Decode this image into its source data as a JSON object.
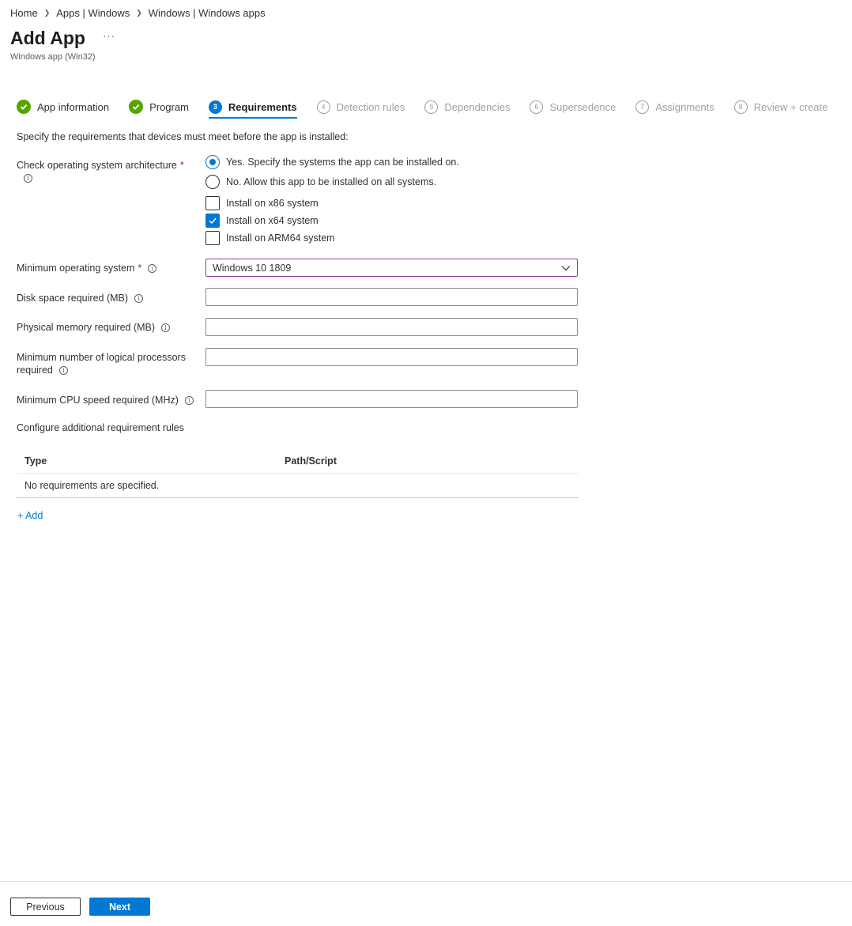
{
  "breadcrumb": {
    "items": [
      "Home",
      "Apps | Windows",
      "Windows | Windows apps"
    ]
  },
  "header": {
    "title": "Add App",
    "more": "···",
    "subtitle": "Windows app (Win32)"
  },
  "steps": [
    {
      "label": "App information",
      "state": "done"
    },
    {
      "label": "Program",
      "state": "done"
    },
    {
      "label": "Requirements",
      "state": "current",
      "number": "3"
    },
    {
      "label": "Detection rules",
      "state": "todo",
      "number": "4"
    },
    {
      "label": "Dependencies",
      "state": "todo",
      "number": "5"
    },
    {
      "label": "Supersedence",
      "state": "todo",
      "number": "6"
    },
    {
      "label": "Assignments",
      "state": "todo",
      "number": "7"
    },
    {
      "label": "Review + create",
      "state": "todo",
      "number": "8"
    }
  ],
  "form": {
    "intro": "Specify the requirements that devices must meet before the app is installed:",
    "arch_label": "Check operating system architecture",
    "required_mark": "*",
    "arch_options": [
      {
        "label": "Yes. Specify the systems the app can be installed on.",
        "selected": true
      },
      {
        "label": "No. Allow this app to be installed on all systems.",
        "selected": false
      }
    ],
    "arch_checks": [
      {
        "label": "Install on x86 system",
        "checked": false
      },
      {
        "label": "Install on x64 system",
        "checked": true
      },
      {
        "label": "Install on ARM64 system",
        "checked": false
      }
    ],
    "min_os_label": "Minimum operating system",
    "min_os_value": "Windows 10 1809",
    "disk_label": "Disk space required (MB)",
    "disk_value": "",
    "memory_label": "Physical memory required (MB)",
    "memory_value": "",
    "processors_label_line1": "Minimum number of logical processors",
    "processors_label_line2": "required",
    "processors_value": "",
    "cpu_label": "Minimum CPU speed required (MHz)",
    "cpu_value": "",
    "info_glyph": "i"
  },
  "rules": {
    "section_label": "Configure additional requirement rules",
    "columns": [
      "Type",
      "Path/Script"
    ],
    "empty_text": "No requirements are specified.",
    "add_label": "+ Add"
  },
  "footer": {
    "previous_label": "Previous",
    "next_label": "Next"
  },
  "colors": {
    "accent": "#0078d4",
    "done_green": "#57a300",
    "required_red": "#a4262c",
    "select_border": "#8a3b9e"
  }
}
